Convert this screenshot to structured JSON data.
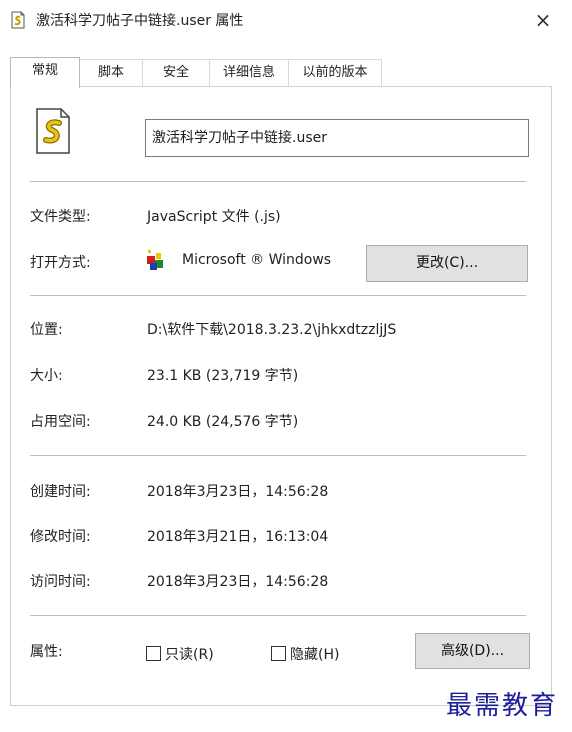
{
  "window": {
    "title": "激活科学刀帖子中链接.user 属性",
    "close_icon": "×"
  },
  "tabs": [
    {
      "label": "常规",
      "active": true
    },
    {
      "label": "脚本",
      "active": false
    },
    {
      "label": "安全",
      "active": false
    },
    {
      "label": "详细信息",
      "active": false
    },
    {
      "label": "以前的版本",
      "active": false
    }
  ],
  "general": {
    "file_name": "激活科学刀帖子中链接.user",
    "file_type_label": "文件类型:",
    "file_type_value": "JavaScript 文件 (.js)",
    "open_with_label": "打开方式:",
    "open_with_value": "Microsoft ® Windows",
    "change_button": "更改(C)...",
    "location_label": "位置:",
    "location_value": "D:\\软件下载\\2018.3.23.2\\jhkxdtzzljJS",
    "size_label": "大小:",
    "size_value": "23.1 KB (23,719 字节)",
    "disk_size_label": "占用空间:",
    "disk_size_value": "24.0 KB (24,576 字节)",
    "created_label": "创建时间:",
    "created_value": "2018年3月23日，14:56:28",
    "modified_label": "修改时间:",
    "modified_value": "2018年3月21日，16:13:04",
    "accessed_label": "访问时间:",
    "accessed_value": "2018年3月23日，14:56:28",
    "attributes_label": "属性:",
    "readonly_label": "只读(R)",
    "readonly_checked": false,
    "hidden_label": "隐藏(H)",
    "hidden_checked": false,
    "advanced_button": "高级(D)..."
  },
  "watermark": "最需教育",
  "colors": {
    "watermark": "#1e1e9a",
    "button_bg": "#e1e1e1",
    "separator": "#bcbcbc"
  }
}
